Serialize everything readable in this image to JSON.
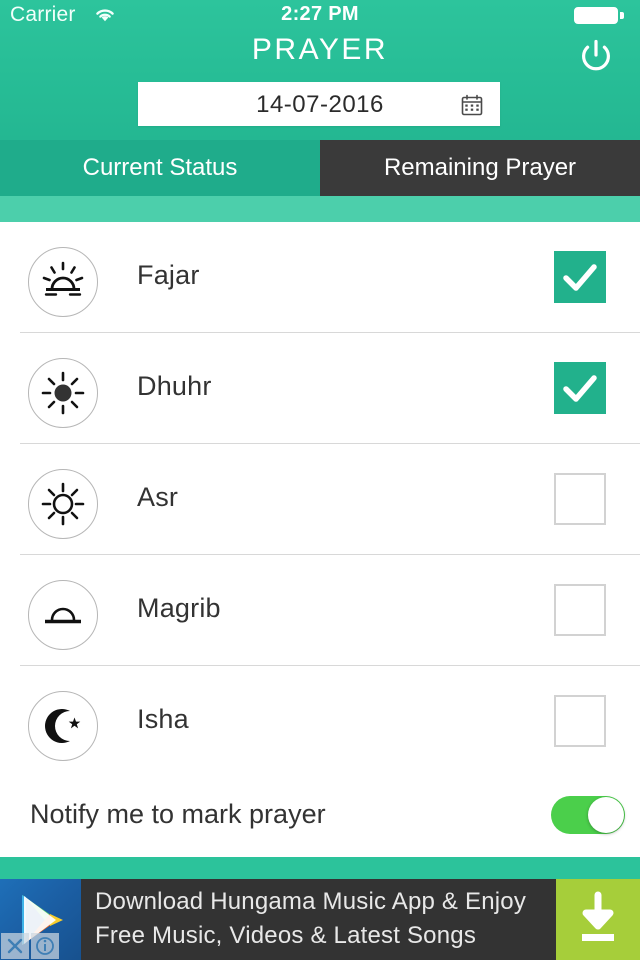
{
  "status_bar": {
    "carrier": "Carrier",
    "time": "2:27 PM",
    "wifi_icon": "wifi-icon",
    "battery_icon": "battery-full-icon"
  },
  "header": {
    "title": "PRAYER",
    "power_icon": "power-icon",
    "date_value": "14-07-2016",
    "date_placeholder": "DD-MM-YYYY",
    "calendar_icon": "calendar-icon",
    "accent_color": "#2dc49c"
  },
  "tabs": [
    {
      "label": "Current Status",
      "active": true,
      "color": "#1fac8b"
    },
    {
      "label": "Remaining Prayer",
      "active": false,
      "color": "#3a3a3a"
    }
  ],
  "prayers": [
    {
      "name": "Fajar",
      "icon": "sunrise-icon",
      "checked": true
    },
    {
      "name": "Dhuhr",
      "icon": "sun-filled-icon",
      "checked": true
    },
    {
      "name": "Asr",
      "icon": "sun-outline-icon",
      "checked": false
    },
    {
      "name": "Magrib",
      "icon": "sunset-icon",
      "checked": false
    },
    {
      "name": "Isha",
      "icon": "crescent-moon-star-icon",
      "checked": false
    }
  ],
  "notify": {
    "label": "Notify me to mark prayer",
    "enabled": true,
    "toggle_color": "#4bcf4b"
  },
  "ad": {
    "line1": "Download Hungama Music App & Enjoy",
    "line2": "Free Music, Videos & Latest Songs",
    "app_icon": "google-play-icon",
    "cta_icon": "download-arrow-icon",
    "cta_color": "#a6ce3a",
    "close_icon": "close-icon",
    "info_icon": "info-icon"
  },
  "colors": {
    "checkbox_checked": "#22b18c",
    "checkbox_unchecked_border": "#d2d2d2",
    "list_divider": "#d8d8d8"
  }
}
